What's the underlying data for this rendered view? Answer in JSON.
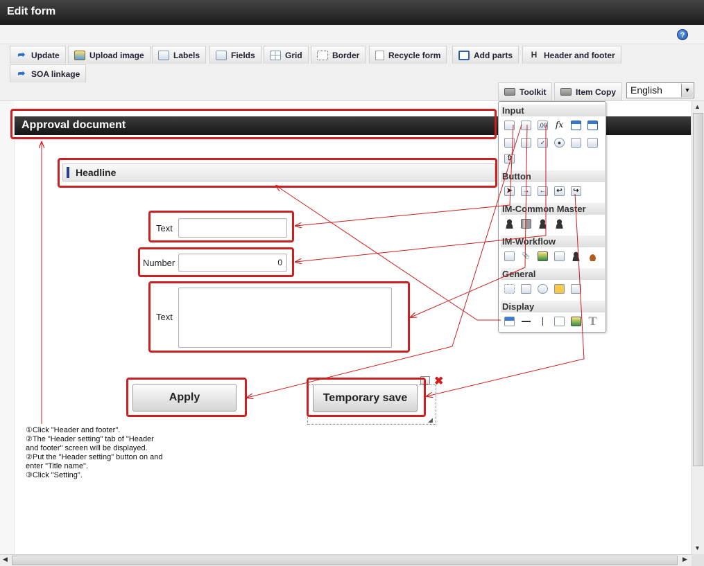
{
  "window": {
    "title": "Edit form"
  },
  "toolbar": {
    "buttons": [
      {
        "label": "Update",
        "icon": "update-icon"
      },
      {
        "label": "Upload image",
        "icon": "upload-image-icon"
      },
      {
        "label": "Labels",
        "icon": "labels-icon"
      },
      {
        "label": "Fields",
        "icon": "fields-icon"
      },
      {
        "label": "Grid",
        "icon": "grid-icon"
      },
      {
        "label": "Border",
        "icon": "border-icon"
      },
      {
        "label": "Recycle form",
        "icon": "recycle-form-icon"
      },
      {
        "label": "Add parts",
        "icon": "add-parts-icon"
      },
      {
        "label": "Header and footer",
        "icon": "header-footer-icon"
      },
      {
        "label": "SOA linkage",
        "icon": "soa-linkage-icon"
      }
    ],
    "toolkit_label": "Toolkit",
    "item_copy_label": "Item Copy",
    "language": "English",
    "header_icon_glyph": "H"
  },
  "form": {
    "header_title": "Approval document",
    "headline": "Headline",
    "fields": [
      {
        "label": "Text",
        "value": ""
      },
      {
        "label": "Number",
        "value": "0"
      },
      {
        "label": "Text",
        "value": ""
      }
    ],
    "apply_label": "Apply",
    "temp_save_label": "Temporary save"
  },
  "palette": {
    "sections": [
      "Input",
      "Button",
      "IM-Common Master",
      "IM-Workflow",
      "General",
      "Display"
    ],
    "fx_glyph": "fx",
    "text_glyph": "T"
  },
  "instructions": [
    "①Click \"Header and footer\".",
    "②The \"Header setting\" tab of \"Header",
    "and footer\" screen will be displayed.",
    "②Put the \"Header setting\" button on and",
    "enter \"Title name\".",
    "③Click \"Setting\"."
  ],
  "colors": {
    "annotation_red": "#cc1f1f",
    "header_dark": "#1b1b1b",
    "headline_accent": "#2b3e8f"
  }
}
